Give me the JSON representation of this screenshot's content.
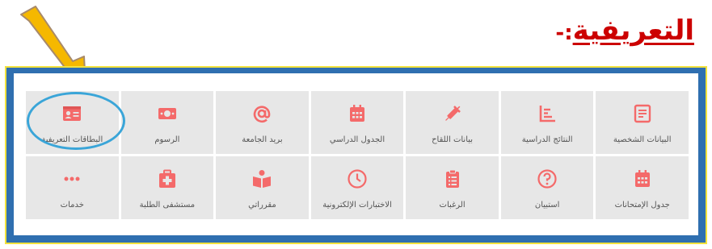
{
  "heading": {
    "title": "التعريفية",
    "separator": ":-"
  },
  "colors": {
    "icon_accent": "#f46a6a",
    "tile_bg": "#e7e7e7",
    "frame_border": "#2f6fb0",
    "highlight_ring": "#3aa5d8",
    "arrow_fill": "#f5b800"
  },
  "tiles": [
    {
      "label": "البيانات الشخصية",
      "icon": "personal-data-icon"
    },
    {
      "label": "النتائج الدراسية",
      "icon": "results-chart-icon"
    },
    {
      "label": "بيانات اللقاح",
      "icon": "vaccine-icon"
    },
    {
      "label": "الجدول الدراسي",
      "icon": "calendar-icon"
    },
    {
      "label": "بريد الجامعة",
      "icon": "at-mail-icon"
    },
    {
      "label": "الرسوم",
      "icon": "money-icon"
    },
    {
      "label": "البطاقات التعريفية",
      "icon": "id-card-icon"
    },
    {
      "label": "جدول الإمتحانات",
      "icon": "exam-calendar-icon"
    },
    {
      "label": "استبيان",
      "icon": "question-icon"
    },
    {
      "label": "الرغبات",
      "icon": "clipboard-icon"
    },
    {
      "label": "الاختبارات الإلكترونية",
      "icon": "clock-icon"
    },
    {
      "label": "مقرراتي",
      "icon": "book-reader-icon"
    },
    {
      "label": "مستشفى الطلبة",
      "icon": "medical-kit-icon"
    },
    {
      "label": "خدمات",
      "icon": "more-dots-icon"
    }
  ]
}
